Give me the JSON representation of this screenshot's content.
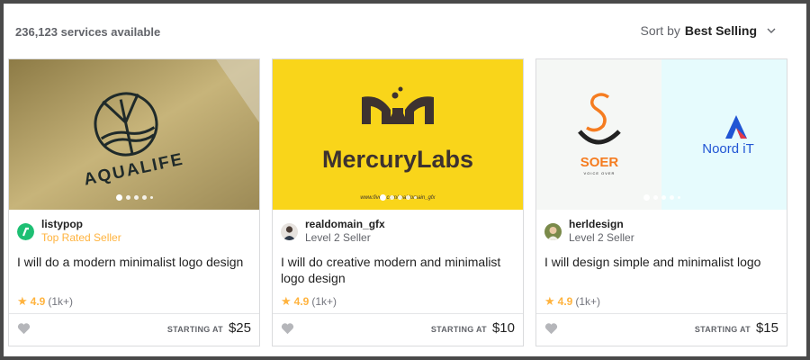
{
  "results": {
    "count_text": "236,123 services available"
  },
  "sort": {
    "label": "Sort by",
    "value": "Best Selling"
  },
  "gigs": [
    {
      "image_text": "AQUALIFE",
      "seller_name": "listypop",
      "seller_level": "Top Rated Seller",
      "title": "I will do a modern minimalist logo design",
      "rating": "4.9",
      "rating_count": "(1k+)",
      "price_label": "STARTING AT",
      "price": "$25"
    },
    {
      "image_text": "MercuryLabs",
      "image_subtext": "www.fiverr.com/realdomain_gfx",
      "seller_name": "realdomain_gfx",
      "seller_level": "Level 2 Seller",
      "title": "I will do creative modern and minimalist logo design",
      "rating": "4.9",
      "rating_count": "(1k+)",
      "price_label": "STARTING AT",
      "price": "$10"
    },
    {
      "image_text_left": "SOER",
      "image_text_left_sub": "VOICE OVER",
      "image_text_right": "Noord iT",
      "seller_name": "herldesign",
      "seller_level": "Level 2 Seller",
      "title": "I will design simple and minimalist logo",
      "rating": "4.9",
      "rating_count": "(1k+)",
      "price_label": "STARTING AT",
      "price": "$15"
    }
  ]
}
